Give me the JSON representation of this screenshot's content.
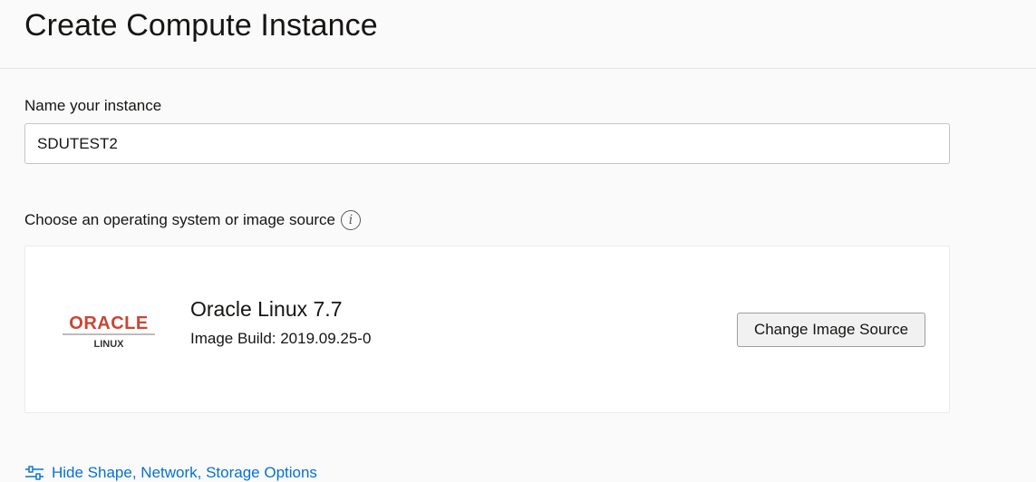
{
  "page": {
    "title": "Create Compute Instance"
  },
  "name_section": {
    "label": "Name your instance",
    "value": "SDUTEST2"
  },
  "os_section": {
    "label": "Choose an operating system or image source",
    "info_icon": "info-icon"
  },
  "image_card": {
    "logo_text": "ORACLE",
    "logo_subtext": "LINUX",
    "image_name": "Oracle Linux 7.7",
    "image_build": "Image Build: 2019.09.25-0",
    "change_button_label": "Change Image Source"
  },
  "footer_link": {
    "label": "Hide Shape, Network, Storage Options",
    "icon": "settings-sliders-icon"
  },
  "colors": {
    "oracle_red": "#c74634",
    "link_blue": "#0572ce",
    "background": "#fafafa"
  }
}
